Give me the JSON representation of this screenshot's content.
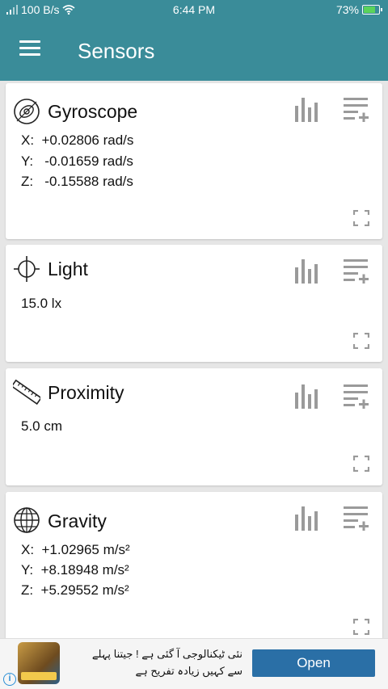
{
  "status_bar": {
    "speed": "100 B/s",
    "time": "6:44 PM",
    "battery": "73%"
  },
  "app_bar": {
    "title": "Sensors"
  },
  "cards": [
    {
      "title": "Gyroscope",
      "values": [
        "X:  +0.02806 rad/s",
        "Y:   -0.01659 rad/s",
        "Z:   -0.15588 rad/s"
      ]
    },
    {
      "title": "Light",
      "values": [
        "15.0 lx"
      ]
    },
    {
      "title": "Proximity",
      "values": [
        "5.0 cm"
      ]
    },
    {
      "title": "Gravity",
      "values": [
        "X:  +1.02965 m/s²",
        "Y:  +8.18948 m/s²",
        "Z:  +5.29552 m/s²"
      ]
    }
  ],
  "ad": {
    "line1": "نئی ٹیکنالوجی آ گئی ہے ! جیتنا پہلے",
    "line2": "سے کہیں زیادہ تفریح ہے",
    "open_label": "Open",
    "info_label": "i"
  },
  "colors": {
    "primary": "#3a8c99",
    "icon_gray": "#9a9a9a",
    "ad_button": "#2a6fa6"
  }
}
